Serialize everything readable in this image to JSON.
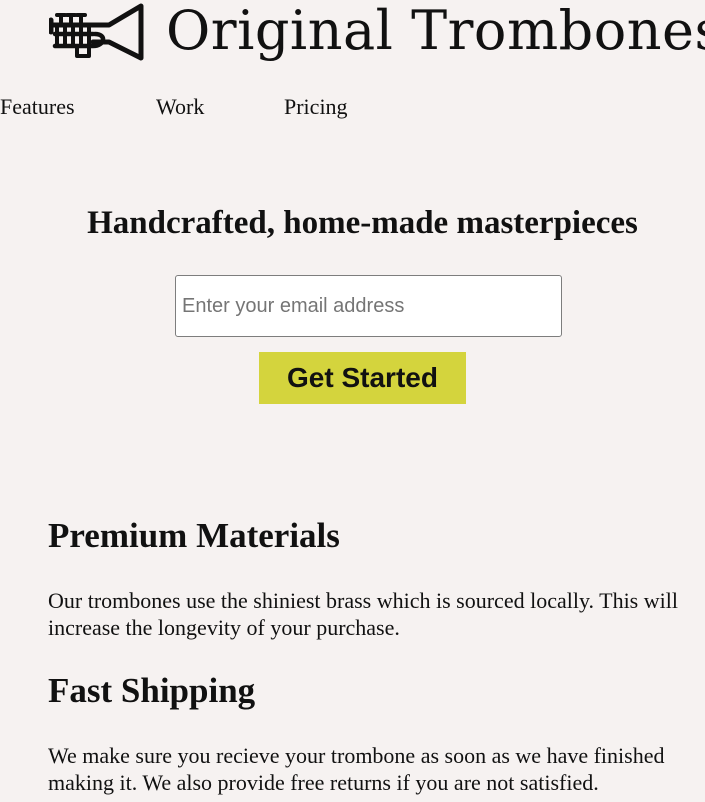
{
  "header": {
    "brand": "Original Trombones",
    "logo_icon": "trumpet-icon"
  },
  "nav": {
    "items": [
      {
        "label": "Features"
      },
      {
        "label": "Work"
      },
      {
        "label": "Pricing"
      }
    ]
  },
  "hero": {
    "title": "Handcrafted, home-made masterpieces",
    "email_placeholder": "Enter your email address",
    "cta_label": "Get Started"
  },
  "features": [
    {
      "title": "Premium Materials",
      "text": "Our trombones use the shiniest brass which is sourced locally. This will increase the longevity of your purchase."
    },
    {
      "title": "Fast Shipping",
      "text": "We make sure you recieve your trombone as soon as we have finished making it. We also provide free returns if you are not satisfied."
    }
  ],
  "colors": {
    "background": "#f6f2f1",
    "cta": "#d4d43d",
    "text": "#111111"
  }
}
